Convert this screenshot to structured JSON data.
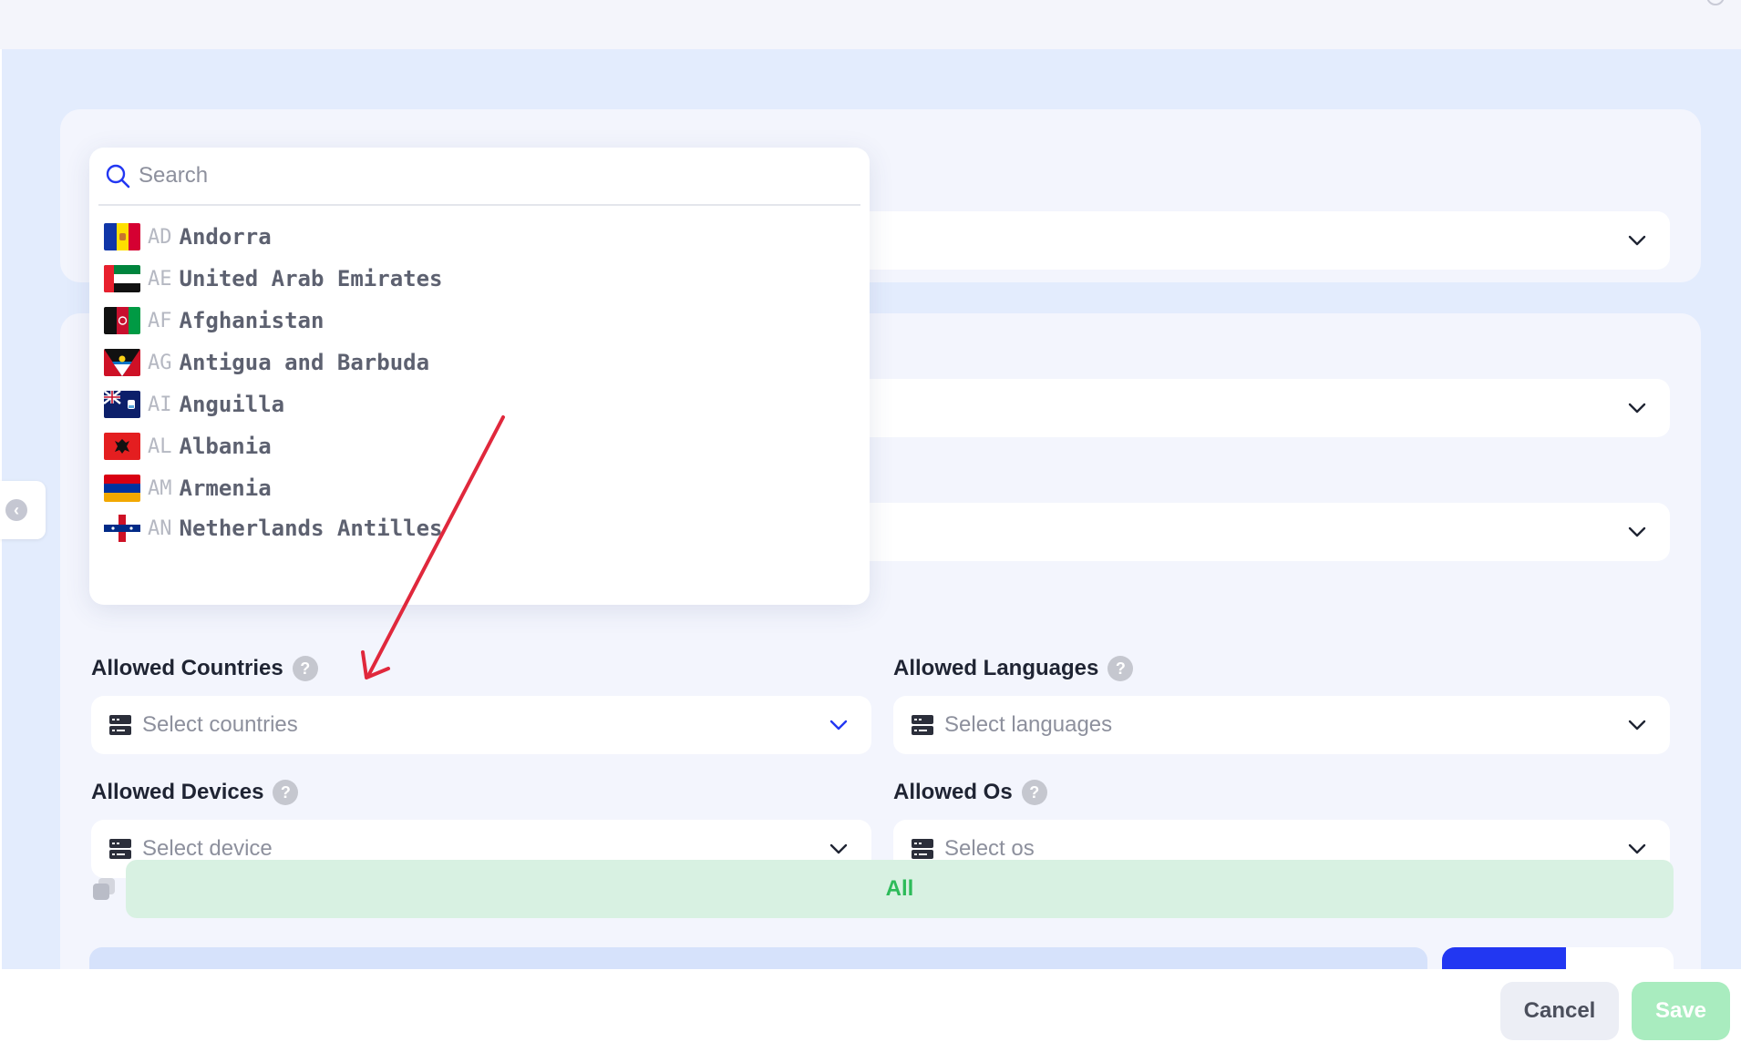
{
  "search": {
    "placeholder": "Search"
  },
  "countries": [
    {
      "code": "AD",
      "name": "Andorra"
    },
    {
      "code": "AE",
      "name": "United Arab Emirates"
    },
    {
      "code": "AF",
      "name": "Afghanistan"
    },
    {
      "code": "AG",
      "name": "Antigua and Barbuda"
    },
    {
      "code": "AI",
      "name": "Anguilla"
    },
    {
      "code": "AL",
      "name": "Albania"
    },
    {
      "code": "AM",
      "name": "Armenia"
    },
    {
      "code": "AN",
      "name": "Netherlands Antilles"
    }
  ],
  "fields": {
    "countries": {
      "label": "Allowed Countries",
      "placeholder": "Select countries"
    },
    "languages": {
      "label": "Allowed Languages",
      "placeholder": "Select languages"
    },
    "devices": {
      "label": "Allowed Devices",
      "placeholder": "Select device"
    },
    "os": {
      "label": "Allowed Os",
      "placeholder": "Select os"
    },
    "help_glyph": "?"
  },
  "all_label": "All",
  "footer": {
    "cancel_label": "Cancel",
    "save_label": "Save"
  },
  "colors": {
    "accent": "#2237f2",
    "success": "#2dbb5a",
    "annotation": "#e0283c"
  }
}
